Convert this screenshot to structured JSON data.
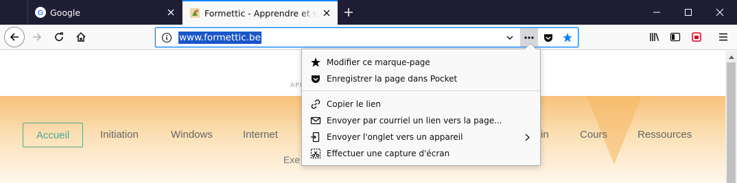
{
  "tabs": [
    {
      "title": "Google",
      "favicon": "google-g-icon",
      "active": false
    },
    {
      "title": "Formettic - Apprendre et s'exercer",
      "favicon": "formettic-icon",
      "active": true
    }
  ],
  "window": {
    "minimize": "minimize-icon",
    "maximize": "maximize-icon",
    "close": "close-icon"
  },
  "urlbar": {
    "value": "www.formettic.be"
  },
  "colors": {
    "accent": "#0a84ff",
    "tabstrip": "#1f1d34",
    "selection": "#1a56c8",
    "bookmark_star": "#0a84ff",
    "menu_active": "#51a88c"
  },
  "page": {
    "tagline": "APP",
    "menu": [
      "Accueil",
      "Initiation",
      "Windows",
      "Internet",
      "in",
      "Cours",
      "Ressources"
    ],
    "subtext": "Exe"
  },
  "page_action_menu": {
    "items": [
      {
        "label": "Modifier ce marque-page",
        "icon": "star-icon"
      },
      {
        "label": "Enregistrer la page dans Pocket",
        "icon": "pocket-icon"
      },
      {
        "label": "Copier le lien",
        "icon": "link-icon"
      },
      {
        "label": "Envoyer par courriel un lien vers la page...",
        "icon": "mail-icon"
      },
      {
        "label": "Envoyer l'onglet vers un appareil",
        "icon": "send-tab-icon",
        "submenu": true
      },
      {
        "label": "Effectuer une capture d'écran",
        "icon": "screenshot-icon"
      }
    ]
  }
}
